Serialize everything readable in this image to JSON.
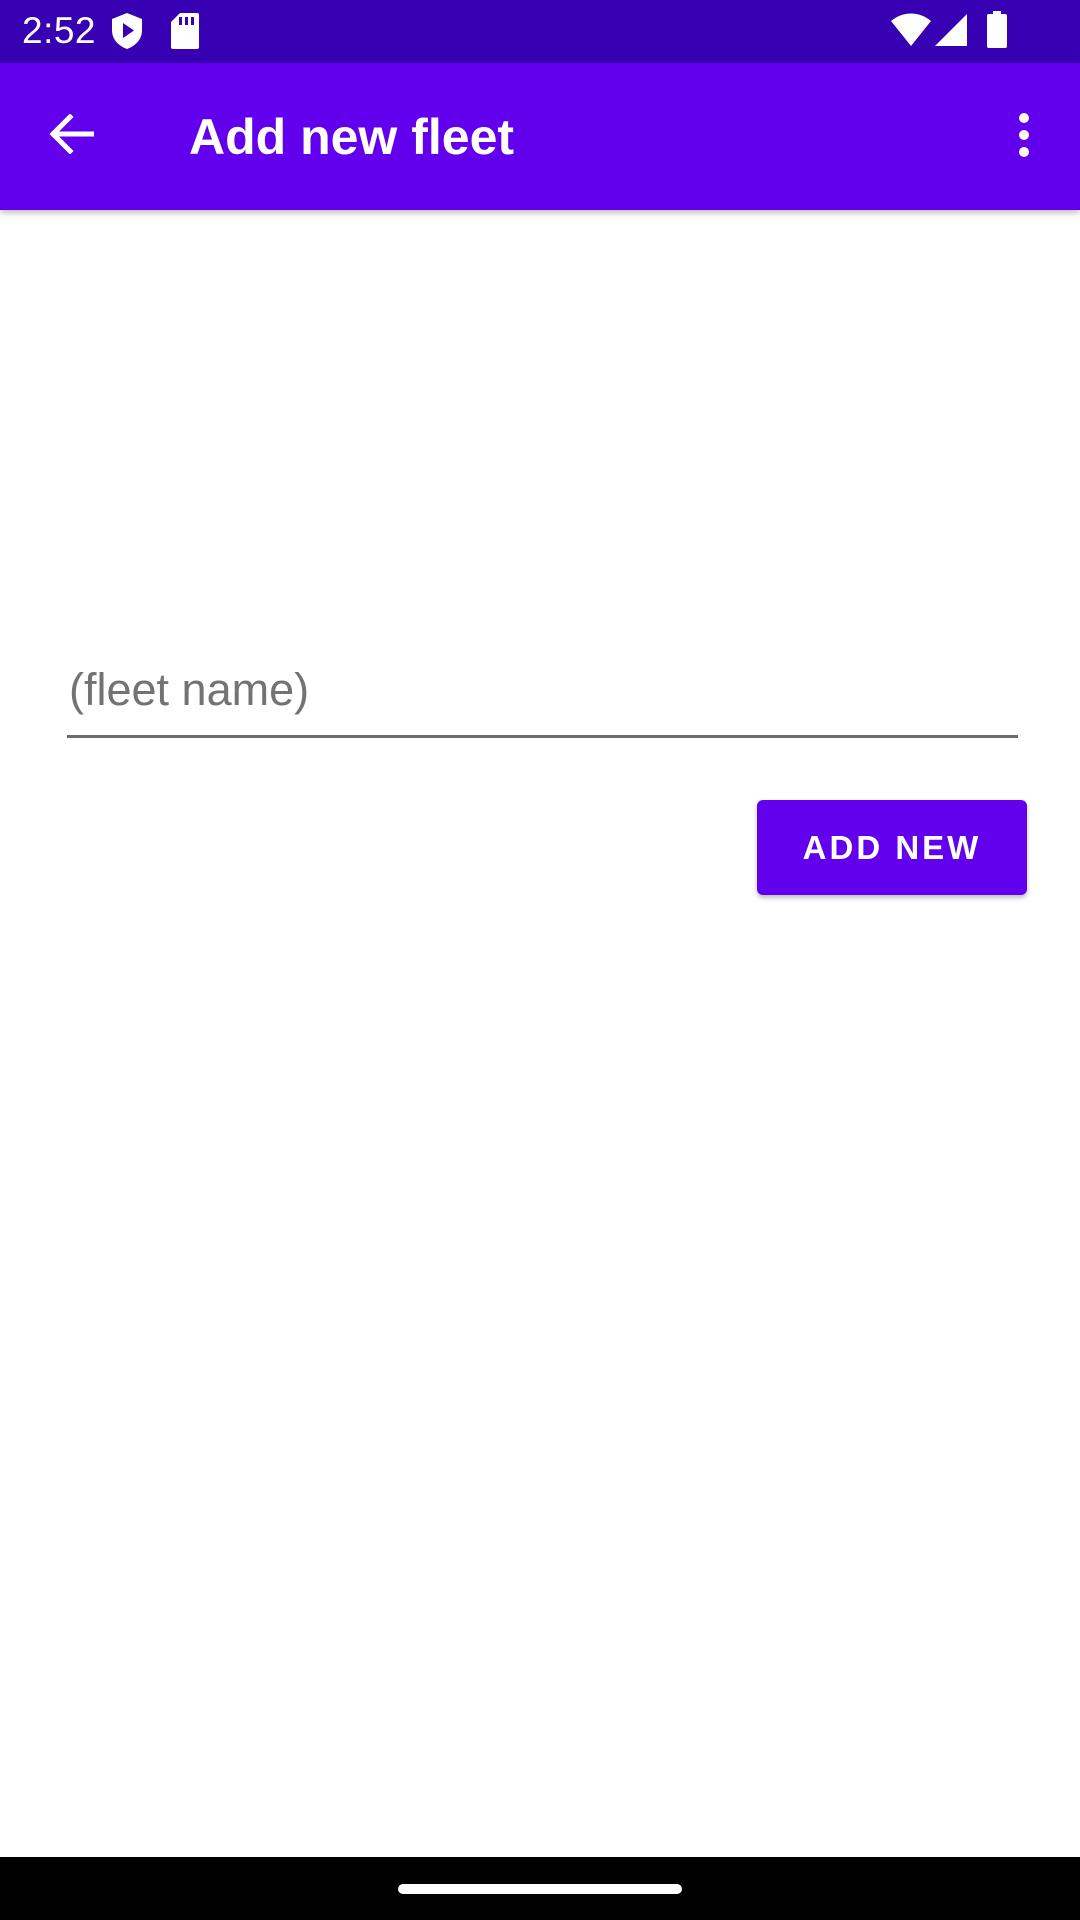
{
  "status_bar": {
    "time": "2:52",
    "icons": [
      "play-protect-icon",
      "sd-card-icon",
      "wifi-icon",
      "cell-signal-icon",
      "battery-icon"
    ]
  },
  "app_bar": {
    "title": "Add new fleet",
    "back_icon": "arrow-back-icon",
    "overflow_icon": "more-vert-icon"
  },
  "form": {
    "fleet_name_value": "",
    "fleet_name_placeholder": "(fleet name)",
    "add_button_label": "ADD NEW"
  },
  "colors": {
    "status_bar": "#3700b3",
    "primary": "#6200ee",
    "background": "#ffffff",
    "nav_bar": "#000000"
  }
}
